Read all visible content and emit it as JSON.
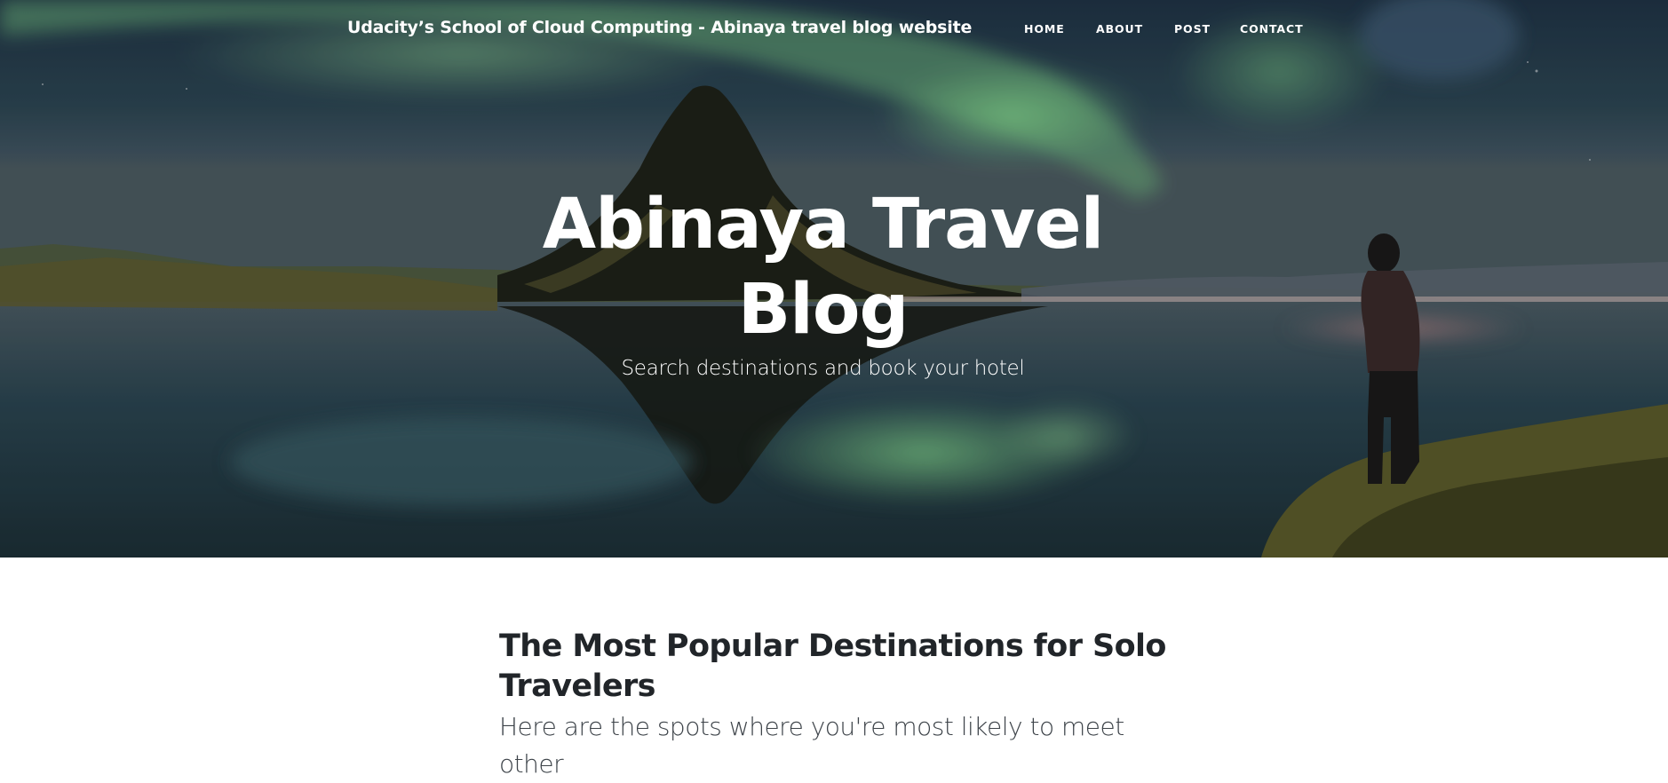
{
  "navbar": {
    "brand": "Udacity’s School of Cloud Computing - Abinaya travel blog website",
    "links": [
      {
        "label": "HOME"
      },
      {
        "label": "ABOUT"
      },
      {
        "label": "POST"
      },
      {
        "label": "CONTACT"
      }
    ]
  },
  "hero": {
    "title_line1": "Abinaya Travel",
    "title_line2": "Blog",
    "subtitle": "Search destinations and book your hotel"
  },
  "post": {
    "title": "The Most Popular Destinations for Solo Travelers",
    "subtitle": "Here are the spots where you're most likely to meet other"
  },
  "colors": {
    "heading_text": "#212529",
    "hero_text": "#ffffff"
  }
}
